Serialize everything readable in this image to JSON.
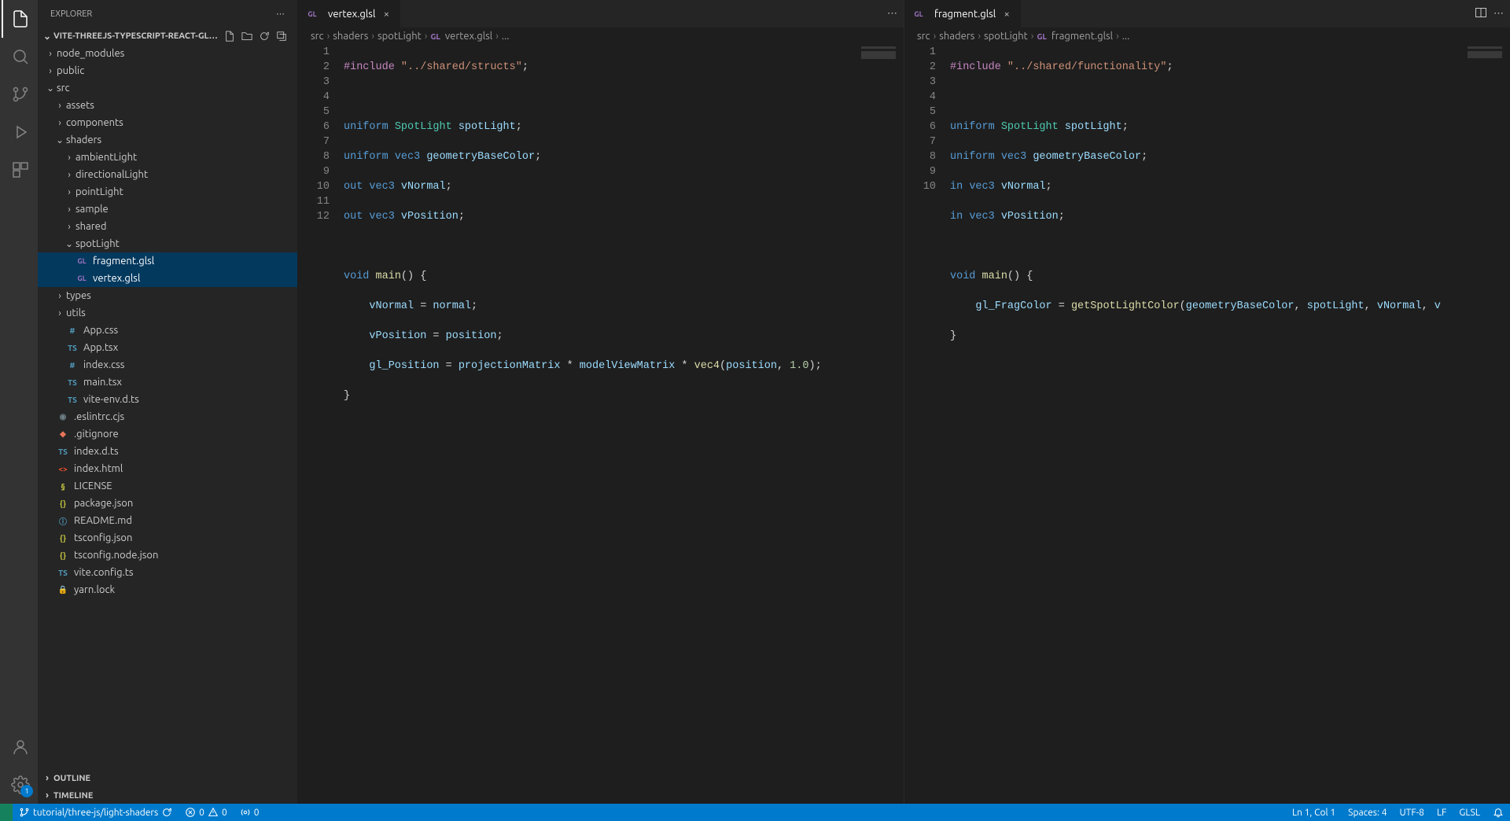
{
  "sidebar": {
    "title": "EXPLORER",
    "project": "VITE-THREEJS-TYPESCRIPT-REACT-GLSL-STARTER-...",
    "outline": "OUTLINE",
    "timeline": "TIMELINE"
  },
  "tree": {
    "node_modules": "node_modules",
    "public": "public",
    "src": "src",
    "assets": "assets",
    "components": "components",
    "shaders": "shaders",
    "ambientLight": "ambientLight",
    "directionalLight": "directionalLight",
    "pointLight": "pointLight",
    "sample": "sample",
    "shared": "shared",
    "spotLight": "spotLight",
    "fragment_glsl": "fragment.glsl",
    "vertex_glsl": "vertex.glsl",
    "types": "types",
    "utils": "utils",
    "App_css": "App.css",
    "App_tsx": "App.tsx",
    "index_css": "index.css",
    "main_tsx": "main.tsx",
    "vite_env": "vite-env.d.ts",
    "eslintrc": ".eslintrc.cjs",
    "gitignore": ".gitignore",
    "index_d_ts": "index.d.ts",
    "index_html": "index.html",
    "license": "LICENSE",
    "package_json": "package.json",
    "readme": "README.md",
    "tsconfig": "tsconfig.json",
    "tsconfig_node": "tsconfig.node.json",
    "vite_config": "vite.config.ts",
    "yarn_lock": "yarn.lock"
  },
  "editor1": {
    "tab": "vertex.glsl",
    "breadcrumb": {
      "p1": "src",
      "p2": "shaders",
      "p3": "spotLight",
      "p4": "vertex.glsl",
      "p5": "..."
    },
    "lines": [
      "1",
      "2",
      "3",
      "4",
      "5",
      "6",
      "7",
      "8",
      "9",
      "10",
      "11",
      "12"
    ],
    "code": {
      "l1a": "#include ",
      "l1b": "\"../shared/structs\"",
      "l1c": ";",
      "l3a": "uniform ",
      "l3b": "SpotLight ",
      "l3c": "spotLight",
      "l3d": ";",
      "l4a": "uniform ",
      "l4b": "vec3 ",
      "l4c": "geometryBaseColor",
      "l4d": ";",
      "l5a": "out ",
      "l5b": "vec3 ",
      "l5c": "vNormal",
      "l5d": ";",
      "l6a": "out ",
      "l6b": "vec3 ",
      "l6c": "vPosition",
      "l6d": ";",
      "l8a": "void ",
      "l8b": "main",
      "l8c": "() {",
      "l9a": "    vNormal ",
      "l9b": "=",
      "l9c": " normal",
      "l9d": ";",
      "l10a": "    vPosition ",
      "l10b": "=",
      "l10c": " position",
      "l10d": ";",
      "l11a": "    gl_Position ",
      "l11b": "=",
      "l11c": " projectionMatrix ",
      "l11d": "*",
      "l11e": " modelViewMatrix ",
      "l11f": "*",
      "l11g": " vec4",
      "l11h": "(",
      "l11i": "position",
      "l11j": ", ",
      "l11k": "1.0",
      "l11l": ");",
      "l12a": "}"
    }
  },
  "editor2": {
    "tab": "fragment.glsl",
    "breadcrumb": {
      "p1": "src",
      "p2": "shaders",
      "p3": "spotLight",
      "p4": "fragment.glsl",
      "p5": "..."
    },
    "lines": [
      "1",
      "2",
      "3",
      "4",
      "5",
      "6",
      "7",
      "8",
      "9",
      "10"
    ],
    "code": {
      "l1a": "#include ",
      "l1b": "\"../shared/functionality\"",
      "l1c": ";",
      "l3a": "uniform ",
      "l3b": "SpotLight ",
      "l3c": "spotLight",
      "l3d": ";",
      "l4a": "uniform ",
      "l4b": "vec3 ",
      "l4c": "geometryBaseColor",
      "l4d": ";",
      "l5a": "in ",
      "l5b": "vec3 ",
      "l5c": "vNormal",
      "l5d": ";",
      "l6a": "in ",
      "l6b": "vec3 ",
      "l6c": "vPosition",
      "l6d": ";",
      "l8a": "void ",
      "l8b": "main",
      "l8c": "() {",
      "l9a": "    gl_FragColor ",
      "l9b": "=",
      "l9c": " getSpotLightColor",
      "l9d": "(",
      "l9e": "geometryBaseColor",
      "l9f": ", ",
      "l9g": "spotLight",
      "l9h": ", ",
      "l9i": "vNormal",
      "l9j": ", ",
      "l9k": "v",
      "l10a": "}"
    }
  },
  "status": {
    "branch": "tutorial/three-js/light-shaders",
    "errors": "0",
    "warnings": "0",
    "ports": "0",
    "lncol": "Ln 1, Col 1",
    "spaces": "Spaces: 4",
    "encoding": "UTF-8",
    "eol": "LF",
    "lang": "GLSL"
  },
  "badges": {
    "settings": "1"
  }
}
